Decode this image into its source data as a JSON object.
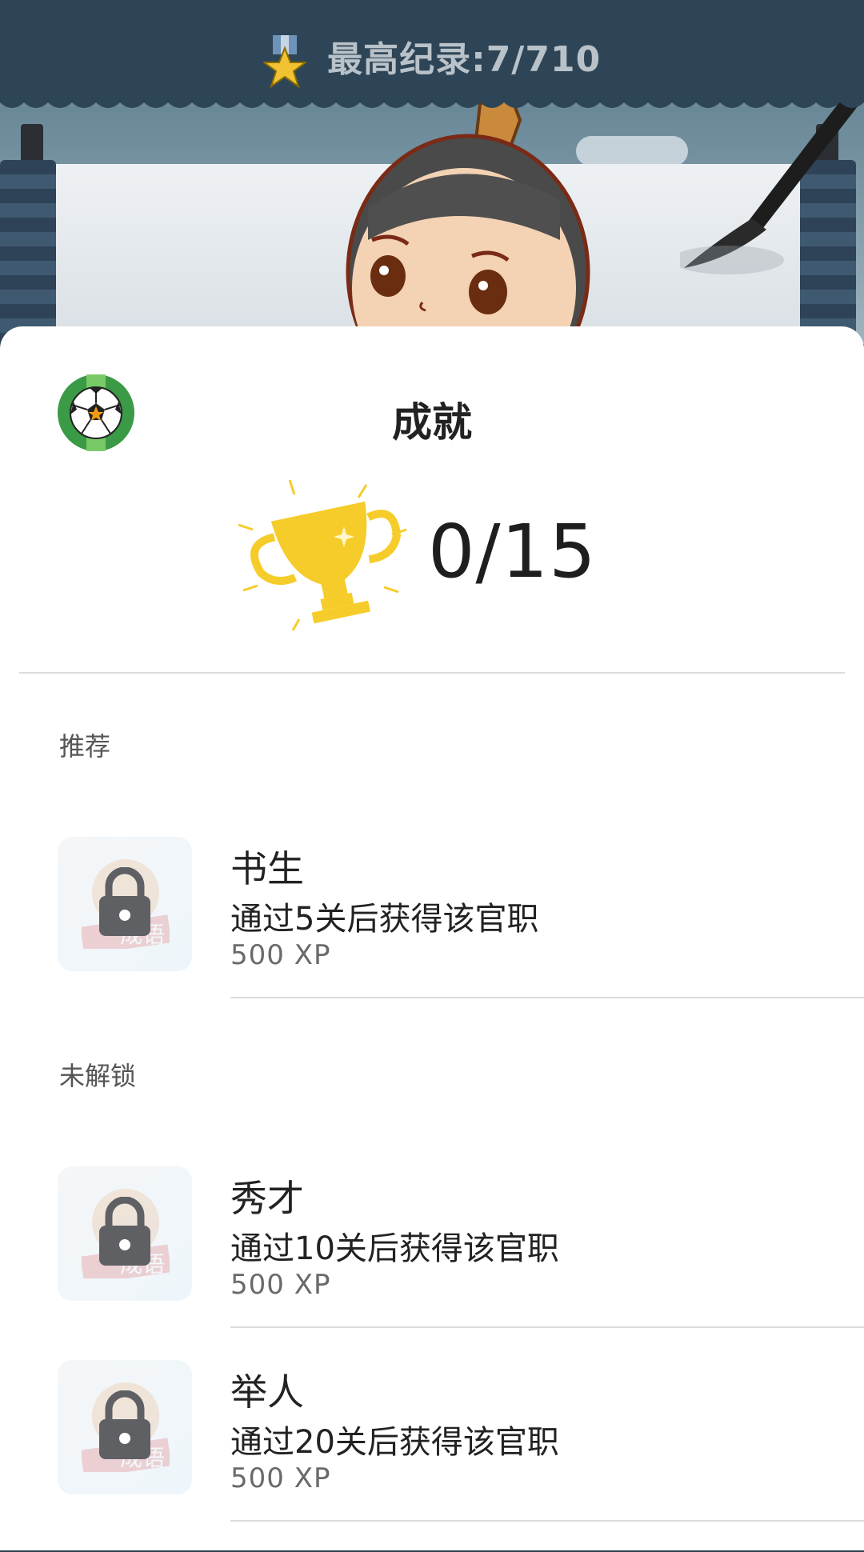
{
  "header": {
    "record_text": "最高纪录:7/710"
  },
  "sheet": {
    "title": "成就",
    "progress": "0/15"
  },
  "sections": [
    {
      "label": "推荐",
      "items": [
        {
          "name": "书生",
          "desc": "通过5关后获得该官职",
          "xp": "500 XP",
          "thumb_text": "成语"
        }
      ]
    },
    {
      "label": "未解锁",
      "items": [
        {
          "name": "秀才",
          "desc": "通过10关后获得该官职",
          "xp": "500 XP",
          "thumb_text": "成语"
        },
        {
          "name": "举人",
          "desc": "通过20关后获得该官职",
          "xp": "500 XP",
          "thumb_text": "成语"
        }
      ]
    }
  ],
  "colors": {
    "header_bg": "#2d4556",
    "trophy": "#f6cc2a",
    "lock": "#5f6064",
    "divider": "#dcdcdc"
  },
  "icons": [
    "medal-star-icon",
    "soccer-ball-icon",
    "trophy-icon",
    "lock-icon"
  ]
}
